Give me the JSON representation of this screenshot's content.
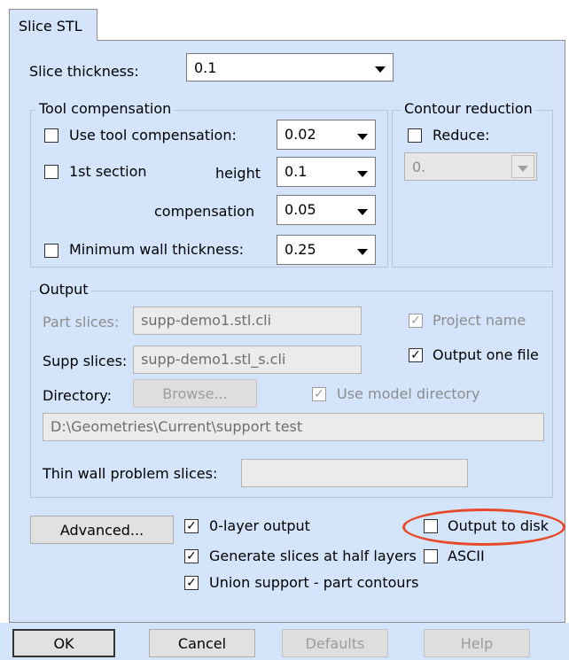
{
  "tab": {
    "label": "Slice STL"
  },
  "slice_thickness": {
    "label": "Slice thickness:",
    "value": "0.1"
  },
  "tool_compensation": {
    "title": "Tool compensation",
    "use_label": "Use tool compensation:",
    "use_value": "0.02",
    "first_section_label": "1st section",
    "height_label": "height",
    "height_value": "0.1",
    "compensation_label": "compensation",
    "compensation_value": "0.05",
    "min_wall_label": "Minimum wall thickness:",
    "min_wall_value": "0.25"
  },
  "contour_reduction": {
    "title": "Contour reduction",
    "reduce_label": "Reduce:",
    "reduce_value": "0."
  },
  "output": {
    "title": "Output",
    "part_slices_label": "Part slices:",
    "part_slices_value": "supp-demo1.stl.cli",
    "project_name_label": "Project name",
    "supp_slices_label": "Supp slices:",
    "supp_slices_value": "supp-demo1.stl_s.cli",
    "output_one_file_label": "Output one file",
    "directory_label": "Directory:",
    "browse_label": "Browse...",
    "use_model_dir_label": "Use model directory",
    "directory_value": "D:\\Geometries\\Current\\support test",
    "thin_wall_label": "Thin wall problem slices:",
    "thin_wall_value": ""
  },
  "bottom": {
    "advanced_label": "Advanced...",
    "zero_layer_label": "0-layer output",
    "output_to_disk_label": "Output to disk",
    "half_layers_label": "Generate slices at half layers",
    "ascii_label": "ASCII",
    "union_label": "Union support - part contours"
  },
  "buttons": {
    "ok": "OK",
    "cancel": "Cancel",
    "defaults": "Defaults",
    "help": "Help"
  },
  "check_mark": "✓",
  "colors": {
    "panel": "#d4e5fb",
    "highlight": "#e8492b"
  }
}
